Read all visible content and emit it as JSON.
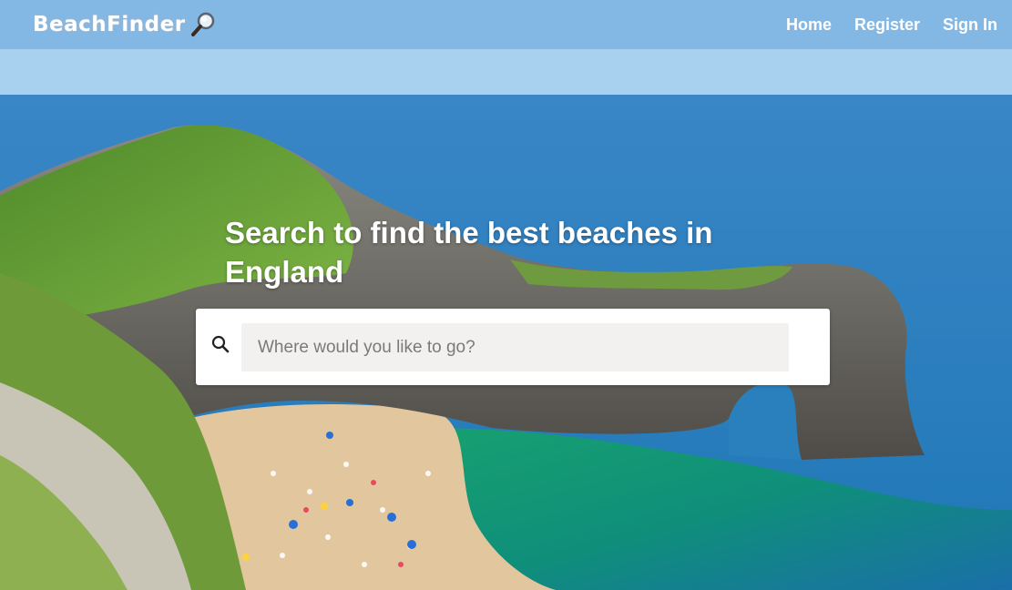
{
  "brand": {
    "name": "BeachFinder",
    "icon": "magnifier-icon"
  },
  "nav": {
    "items": [
      {
        "label": "Home"
      },
      {
        "label": "Register"
      },
      {
        "label": "Sign In"
      }
    ]
  },
  "hero": {
    "title": "Search to find the best beaches in England",
    "image": "coastal-cliff-arch-beach-photo"
  },
  "search": {
    "placeholder": "Where would you like to go?",
    "value": "",
    "icon": "search-icon"
  },
  "colors": {
    "navbar": "#78b0e0",
    "sea": "#2f7fc0",
    "text_on_hero": "#ffffff"
  }
}
